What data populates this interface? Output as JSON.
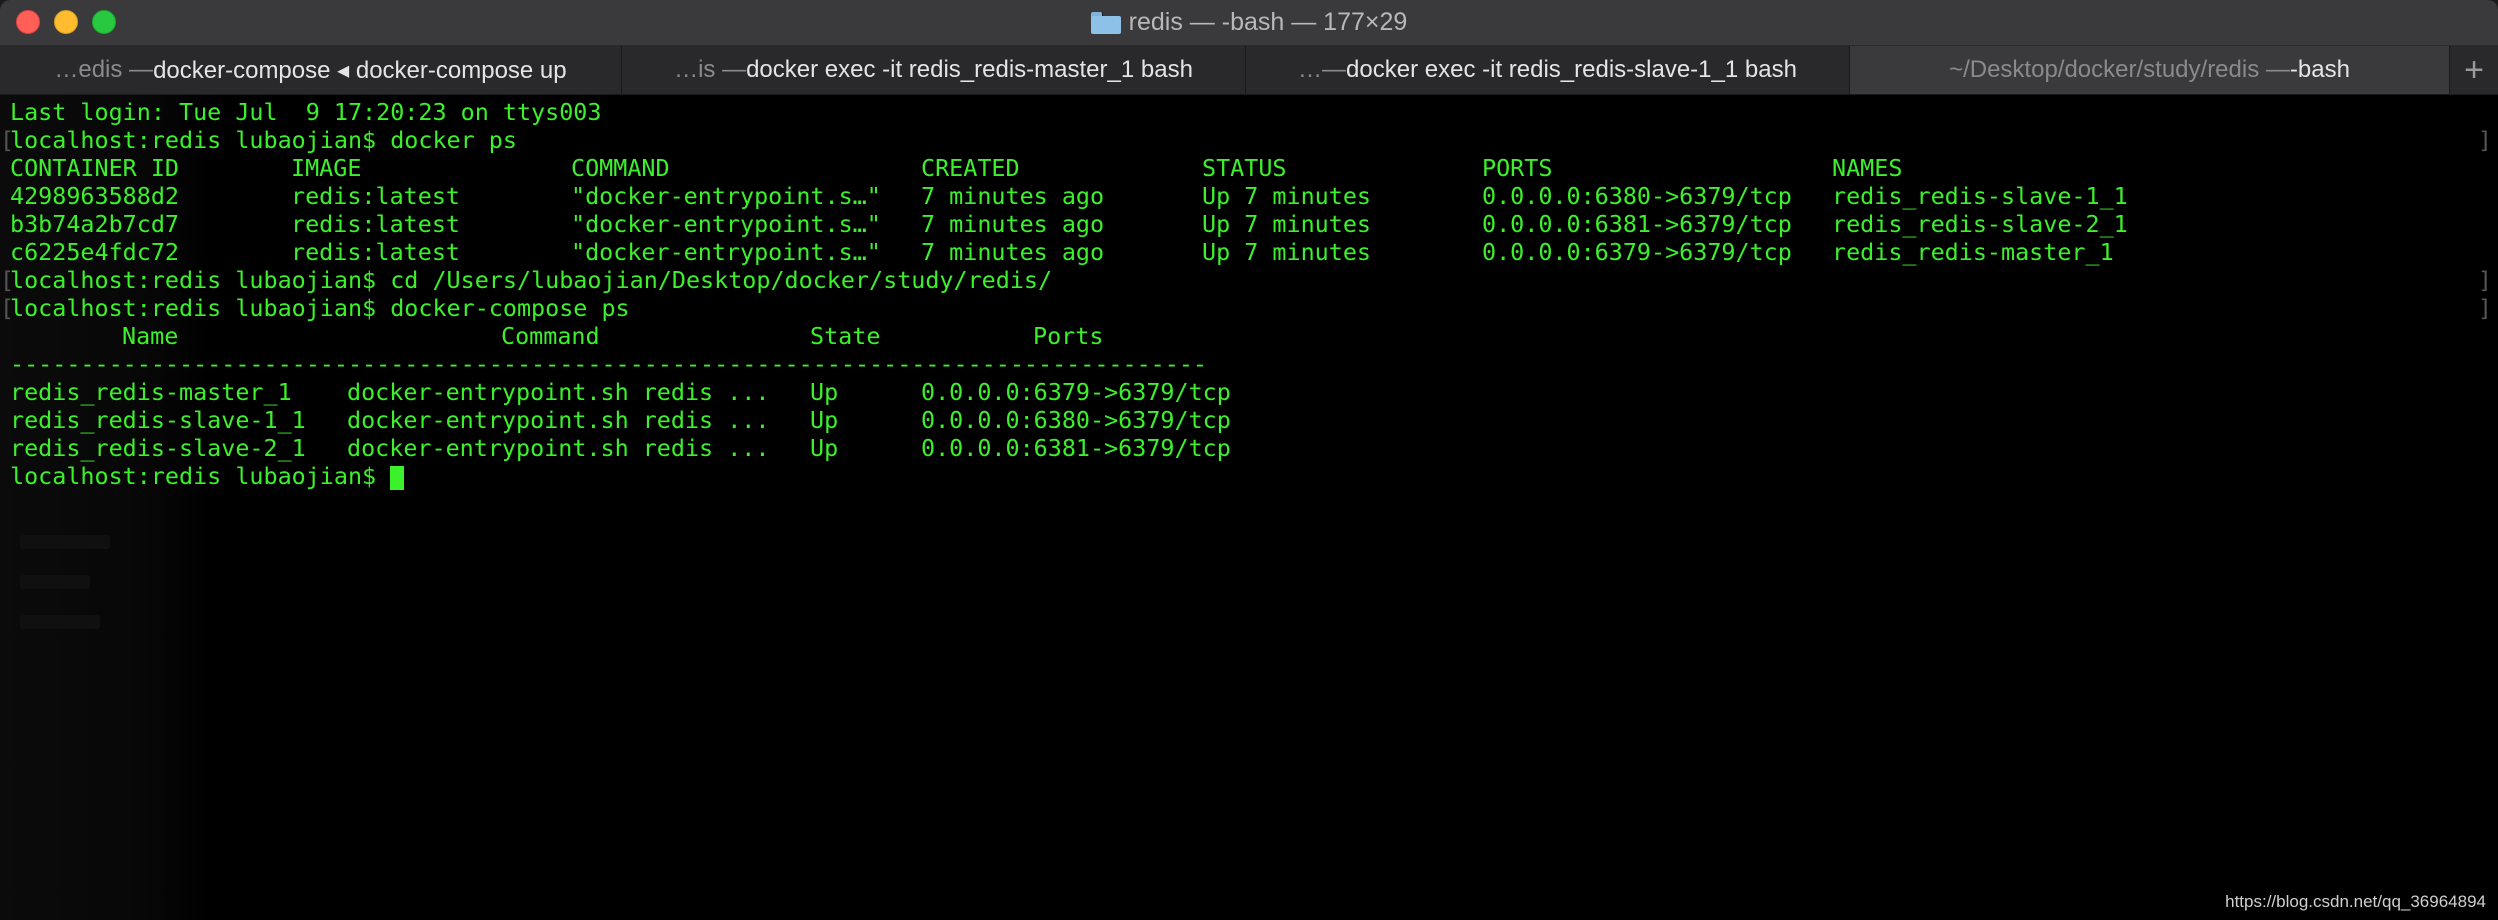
{
  "window": {
    "title": "redis — -bash — 177×29",
    "folder_icon": "folder-icon"
  },
  "tabs": [
    {
      "dim": "…edis — ",
      "strong": "docker-compose ◂ docker-compose up",
      "active": false
    },
    {
      "dim": "…is — ",
      "strong": "docker exec -it redis_redis-master_1 bash",
      "active": false
    },
    {
      "dim": "…— ",
      "strong": "docker exec -it redis_redis-slave-1_1 bash",
      "active": false
    },
    {
      "dim": "~/Desktop/docker/study/redis — ",
      "strong": "-bash",
      "active": true
    }
  ],
  "new_tab_label": "+",
  "terminal": {
    "text_color": "#3cf02c",
    "last_login": "Last login: Tue Jul  9 17:20:23 on ttys003",
    "prompt1": "localhost:redis lubaojian$ docker ps",
    "docker_ps": {
      "headers": [
        "CONTAINER ID",
        "IMAGE",
        "COMMAND",
        "CREATED",
        "STATUS",
        "PORTS",
        "NAMES"
      ],
      "rows": [
        [
          "4298963588d2",
          "redis:latest",
          "\"docker-entrypoint.s…\"",
          "7 minutes ago",
          "Up 7 minutes",
          "0.0.0.0:6380->6379/tcp",
          "redis_redis-slave-1_1"
        ],
        [
          "b3b74a2b7cd7",
          "redis:latest",
          "\"docker-entrypoint.s…\"",
          "7 minutes ago",
          "Up 7 minutes",
          "0.0.0.0:6381->6379/tcp",
          "redis_redis-slave-2_1"
        ],
        [
          "c6225e4fdc72",
          "redis:latest",
          "\"docker-entrypoint.s…\"",
          "7 minutes ago",
          "Up 7 minutes",
          "0.0.0.0:6379->6379/tcp",
          "redis_redis-master_1"
        ]
      ]
    },
    "prompt2": "localhost:redis lubaojian$ cd /Users/lubaojian/Desktop/docker/study/redis/",
    "prompt3": "localhost:redis lubaojian$ docker-compose ps",
    "compose_ps": {
      "headers": [
        "Name",
        "Command",
        "State",
        "Ports"
      ],
      "separator": "-------------------------------------------------------------------------------------",
      "rows": [
        [
          "redis_redis-master_1",
          "docker-entrypoint.sh redis ...",
          "Up",
          "0.0.0.0:6379->6379/tcp"
        ],
        [
          "redis_redis-slave-1_1",
          "docker-entrypoint.sh redis ...",
          "Up",
          "0.0.0.0:6380->6379/tcp"
        ],
        [
          "redis_redis-slave-2_1",
          "docker-entrypoint.sh redis ...",
          "Up",
          "0.0.0.0:6381->6379/tcp"
        ]
      ]
    },
    "prompt4": "localhost:redis lubaojian$ "
  },
  "watermark": "https://blog.csdn.net/qq_36964894"
}
